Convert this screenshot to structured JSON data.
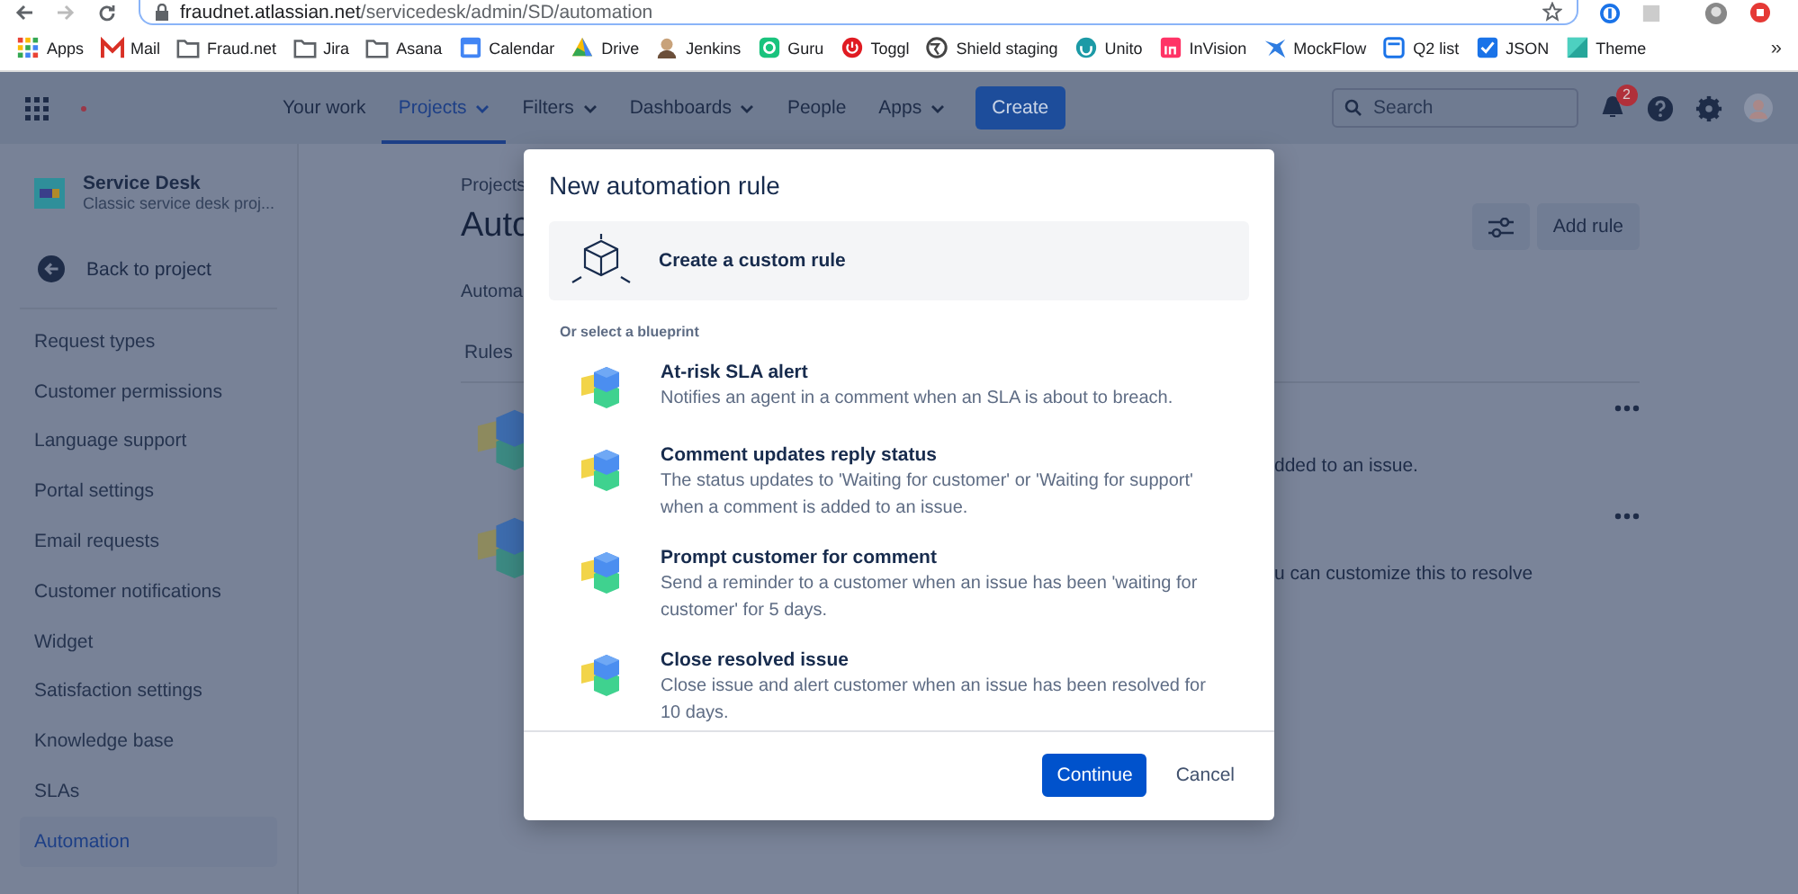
{
  "browser": {
    "url_host": "fraudnet.atlassian.net",
    "url_path": "/servicedesk/admin/SD/automation",
    "bookmarks": [
      {
        "kind": "grid",
        "label": "Apps"
      },
      {
        "kind": "mail",
        "label": "Mail"
      },
      {
        "kind": "folder",
        "label": "Fraud.net"
      },
      {
        "kind": "folder",
        "label": "Jira"
      },
      {
        "kind": "folder",
        "label": "Asana"
      },
      {
        "kind": "calendar",
        "label": "Calendar"
      },
      {
        "kind": "drive",
        "label": "Drive"
      },
      {
        "kind": "avatar",
        "label": "Jenkins"
      },
      {
        "kind": "guru",
        "label": "Guru"
      },
      {
        "kind": "power",
        "label": "Toggl"
      },
      {
        "kind": "globe",
        "label": "Shield staging"
      },
      {
        "kind": "unito",
        "label": "Unito"
      },
      {
        "kind": "invision",
        "label": "InVision"
      },
      {
        "kind": "bird",
        "label": "MockFlow"
      },
      {
        "kind": "q2",
        "label": "Q2 list"
      },
      {
        "kind": "check",
        "label": "JSON"
      },
      {
        "kind": "theme",
        "label": "Theme"
      }
    ],
    "overflow": "»"
  },
  "nav": {
    "items": [
      {
        "label": "Your work",
        "dropdown": false,
        "selected": false
      },
      {
        "label": "Projects",
        "dropdown": true,
        "selected": true
      },
      {
        "label": "Filters",
        "dropdown": true,
        "selected": false
      },
      {
        "label": "Dashboards",
        "dropdown": true,
        "selected": false
      },
      {
        "label": "People",
        "dropdown": false,
        "selected": false
      },
      {
        "label": "Apps",
        "dropdown": true,
        "selected": false
      }
    ],
    "create": "Create",
    "search_placeholder": "Search",
    "notifications": "2"
  },
  "sidebar": {
    "project_name": "Service Desk",
    "project_type": "Classic service desk proj...",
    "back": "Back to project",
    "items": [
      {
        "label": "Request types",
        "selected": false
      },
      {
        "label": "Customer permissions",
        "selected": false
      },
      {
        "label": "Language support",
        "selected": false
      },
      {
        "label": "Portal settings",
        "selected": false
      },
      {
        "label": "Email requests",
        "selected": false
      },
      {
        "label": "Customer notifications",
        "selected": false
      },
      {
        "label": "Widget",
        "selected": false
      },
      {
        "label": "Satisfaction settings",
        "selected": false
      },
      {
        "label": "Knowledge base",
        "selected": false
      },
      {
        "label": "SLAs",
        "selected": false
      },
      {
        "label": "Automation",
        "selected": true
      }
    ]
  },
  "page": {
    "breadcrumb": "Projects",
    "title": "Auto",
    "add_rule": "Add rule",
    "subtitle": "Automa",
    "tab": "Rules",
    "rules": [
      {
        "description": "dded to an issue."
      },
      {
        "description": "u can customize this to resolve"
      }
    ]
  },
  "dialog": {
    "title": "New automation rule",
    "custom_rule": "Create a custom rule",
    "section": "Or select a blueprint",
    "blueprints": [
      {
        "title": "At-risk SLA alert",
        "description": "Notifies an agent in a comment when an SLA is about to breach."
      },
      {
        "title": "Comment updates reply status",
        "description": "The status updates to 'Waiting for customer' or 'Waiting for support' when a comment is added to an issue."
      },
      {
        "title": "Prompt customer for comment",
        "description": "Send a reminder to a customer when an issue has been 'waiting for customer' for 5 days."
      },
      {
        "title": "Close resolved issue",
        "description": "Close issue and alert customer when an issue has been resolved for 10 days."
      }
    ],
    "buttons": [
      {
        "kind": "primary",
        "label": "Continue"
      },
      {
        "kind": "subtle",
        "label": "Cancel"
      }
    ]
  }
}
